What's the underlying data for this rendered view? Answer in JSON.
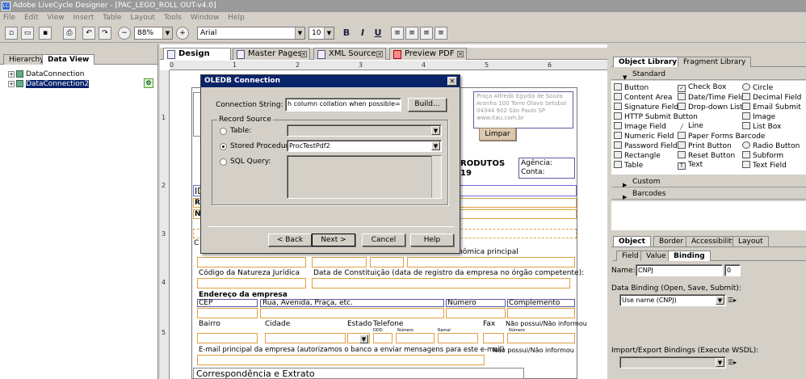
{
  "title_bar": {
    "title": "Adobe LiveCycle Designer - [PAC_LEGO_ROLL OUT-v4.0]"
  },
  "menu": [
    "File",
    "Edit",
    "View",
    "Insert",
    "Table",
    "Layout",
    "Tools",
    "Window",
    "Help"
  ],
  "toolbar": {
    "zoom": "88%",
    "font_name": "Arial",
    "font_size": "10",
    "bold": "B",
    "italic": "I",
    "underline": "U"
  },
  "left_panel": {
    "tabs": [
      "Hierarchy",
      "Data View"
    ],
    "items": [
      "DataConnection",
      "DataConnection2"
    ]
  },
  "doc_tabs": [
    "Design View",
    "Master Pages",
    "XML Source",
    "Preview PDF"
  ],
  "ruler": {
    "top": [
      "0",
      "1",
      "2",
      "3",
      "4",
      "5",
      "6"
    ],
    "left": [
      "1",
      "2",
      "3",
      "4",
      "5"
    ]
  },
  "form": {
    "address": "Praça Alfredo Egydio de Souza\nAranha 100 Torre Olavo Setubal\n04344 902 São Paulo SP\nwww.itau.com.br",
    "limpar": "Limpar",
    "produtos": "RODUTOS",
    "produtos2": "19",
    "agencia": "Agência:",
    "conta": "Conta:",
    "id": "ID",
    "r": "R",
    "n": "N",
    "c": "C",
    "atividade": "Atividade econômica principal",
    "natureza": "Código da Natureza Jurídica",
    "constituicao": "Data de Constituição  (data de registro da empresa no órgão  competente):",
    "endereco": "Endereço da empresa",
    "cep": "CEP",
    "rua": "Rua, Avenida, Praça, etc.",
    "numero": "Número",
    "complemento": "Complemento",
    "bairro": "Bairro",
    "cidade": "Cidade",
    "estado": "Estado",
    "telefone": "Telefone",
    "fax": "Fax",
    "nao_possui": "Não possui/Não informou",
    "ddd": "DDD",
    "numero_sm": "Número",
    "ramal": "Ramal",
    "email": "E-mail principal da empresa (autorizamos o banco a enviar mensagens para este e-mail)",
    "nao_possui2": "Não possui/Não informou",
    "correspondencia": "Correspondência e Extrato"
  },
  "dialog": {
    "title": "OLEDB Connection",
    "connection_label": "Connection String:",
    "connection_value": "h column collation when possible=False",
    "build": "Build...",
    "record_source": "Record Source",
    "table": "Table:",
    "stored_procedure": "Stored Procedure:",
    "stored_procedure_value": "ProcTestPdf2",
    "sql_query": "SQL Query:",
    "back": "< Back",
    "next": "Next >",
    "cancel": "Cancel",
    "help": "Help"
  },
  "right_panel": {
    "tabs": [
      "Object Library",
      "Fragment Library"
    ],
    "standard": "Standard",
    "objects": [
      "Button",
      "Check Box",
      "Circle",
      "Content Area",
      "Date/Time Field",
      "Decimal Field",
      "Signature Field",
      "Drop-down List",
      "Email Submit",
      "HTTP Submit Button",
      "",
      "Image",
      "Image Field",
      "Line",
      "List Box",
      "Numeric Field",
      "Paper Forms Barcode",
      "",
      "Password Field",
      "Print Button",
      "Radio Button",
      "Rectangle",
      "Reset Button",
      "Subform",
      "Table",
      "Text",
      "Text Field"
    ],
    "custom": "Custom",
    "barcodes": "Barcodes",
    "prop_tabs": [
      "Object",
      "Border",
      "Accessibility",
      "Layout"
    ],
    "sub_tabs": [
      "Field",
      "Value",
      "Binding"
    ],
    "name_label": "Name:",
    "name_value": "CNPJ",
    "name_index": "0",
    "data_binding_label": "Data Binding (Open, Save, Submit):",
    "data_binding_value": "Use name (CNPJ)",
    "import_export_label": "Import/Export Bindings (Execute WSDL):"
  }
}
